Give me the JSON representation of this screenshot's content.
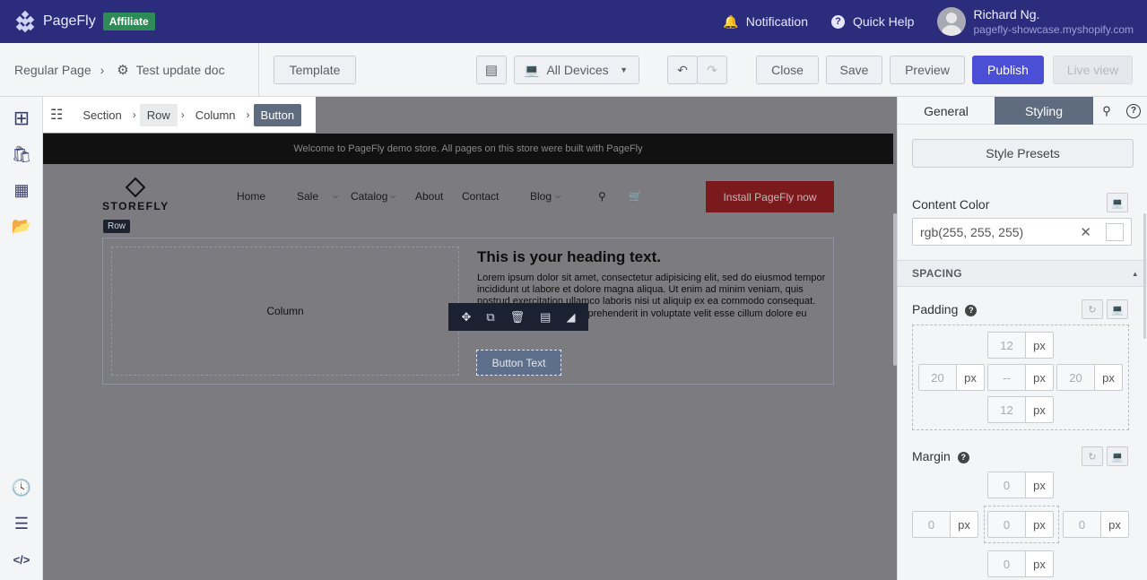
{
  "topbar": {
    "brand": "PageFly",
    "badge": "Affiliate",
    "notification": "Notification",
    "quick_help": "Quick Help",
    "user_name": "Richard Ng.",
    "user_shop": "pagefly-showcase.myshopify.com"
  },
  "toolbar": {
    "page_type": "Regular Page",
    "doc_name": "Test update doc",
    "template": "Template",
    "devices": "All Devices",
    "close": "Close",
    "save": "Save",
    "preview": "Preview",
    "publish": "Publish",
    "live_view": "Live view"
  },
  "breadcrumb": {
    "items": [
      "Section",
      "Row",
      "Column",
      "Button"
    ]
  },
  "store": {
    "announcement": "Welcome to PageFly demo store. All pages on this store were built with PageFly",
    "logo": "STOREFLY",
    "nav": [
      "Home",
      "Sale",
      "Catalog",
      "About",
      "Contact",
      "Blog"
    ],
    "install": "Install PageFly now"
  },
  "canvas": {
    "row_tag": "Row",
    "column_label": "Column",
    "heading": "This is your heading text.",
    "paragraph": "Lorem ipsum dolor sit amet, consectetur adipisicing elit, sed do eiusmod tempor incididunt ut labore et dolore magna aliqua. Ut enim ad minim veniam, quis nostrud exercitation ullamco laboris nisi ut aliquip ex ea commodo consequat. Duis aute irure dolor in reprehenderit in voluptate velit esse cillum dolore eu fugiat nulla pariatur.",
    "button_text": "Button Text"
  },
  "panel": {
    "tab_general": "General",
    "tab_styling": "Styling",
    "style_presets": "Style Presets",
    "content_color_label": "Content Color",
    "content_color_value": "rgb(255, 255, 255)",
    "spacing_header": "SPACING",
    "padding_label": "Padding",
    "margin_label": "Margin",
    "unit": "px",
    "padding": {
      "top": "12",
      "left": "20",
      "center": "--",
      "right": "20",
      "bottom": "12"
    },
    "margin": {
      "top": "0",
      "left": "0",
      "center": "0",
      "right": "0",
      "bottom": "0"
    }
  },
  "colors": {
    "topbar": "#2b2d7c",
    "affiliate": "#2e8b57",
    "publish": "#4a4fd6",
    "active_tab": "#5f6b7e"
  }
}
